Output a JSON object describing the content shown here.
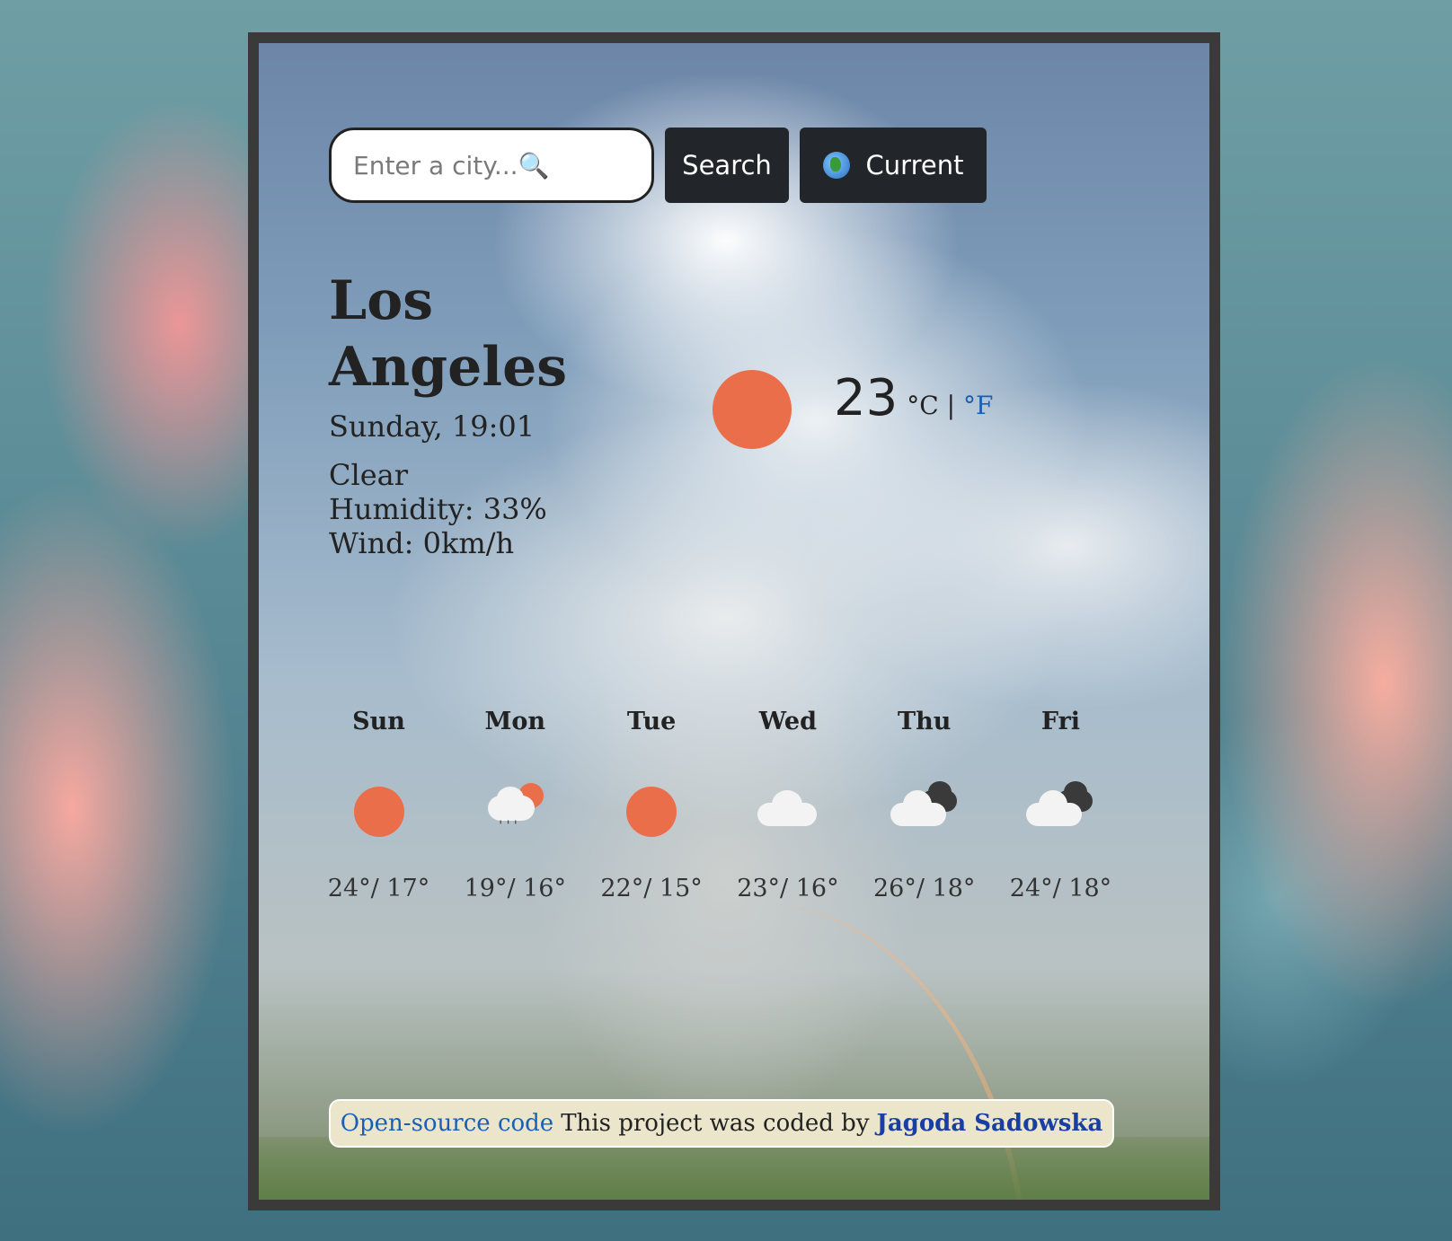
{
  "search": {
    "placeholder": "Enter a city...🔍",
    "search_label": "Search",
    "current_label": "Current",
    "current_icon": "globe-icon"
  },
  "current": {
    "city": "Los Angeles",
    "datetime": "Sunday, 19:01",
    "description": "Clear",
    "humidity": "Humidity: 33%",
    "wind": "Wind: 0km/h",
    "temperature": "23",
    "unit_c": "°C",
    "unit_sep": " | ",
    "unit_f": "°F",
    "icon": "sun-icon",
    "sun_color": "#eb6e4b"
  },
  "forecast": [
    {
      "day": "Sun",
      "icon": "sun-icon",
      "temps": "24°/ 17°"
    },
    {
      "day": "Mon",
      "icon": "rain-sun-cloud-icon",
      "temps": "19°/ 16°"
    },
    {
      "day": "Tue",
      "icon": "sun-icon",
      "temps": "22°/ 15°"
    },
    {
      "day": "Wed",
      "icon": "cloud-icon",
      "temps": "23°/ 16°"
    },
    {
      "day": "Thu",
      "icon": "broken-clouds-icon",
      "temps": "26°/ 18°"
    },
    {
      "day": "Fri",
      "icon": "broken-clouds-icon",
      "temps": "24°/ 18°"
    }
  ],
  "footer": {
    "link_text": "Open-source code",
    "text": "This project was coded by",
    "author": "Jagoda Sadowska"
  },
  "colors": {
    "link": "#1a5fb4",
    "button_bg": "#222529",
    "footer_bg": "#ebe5cc"
  }
}
